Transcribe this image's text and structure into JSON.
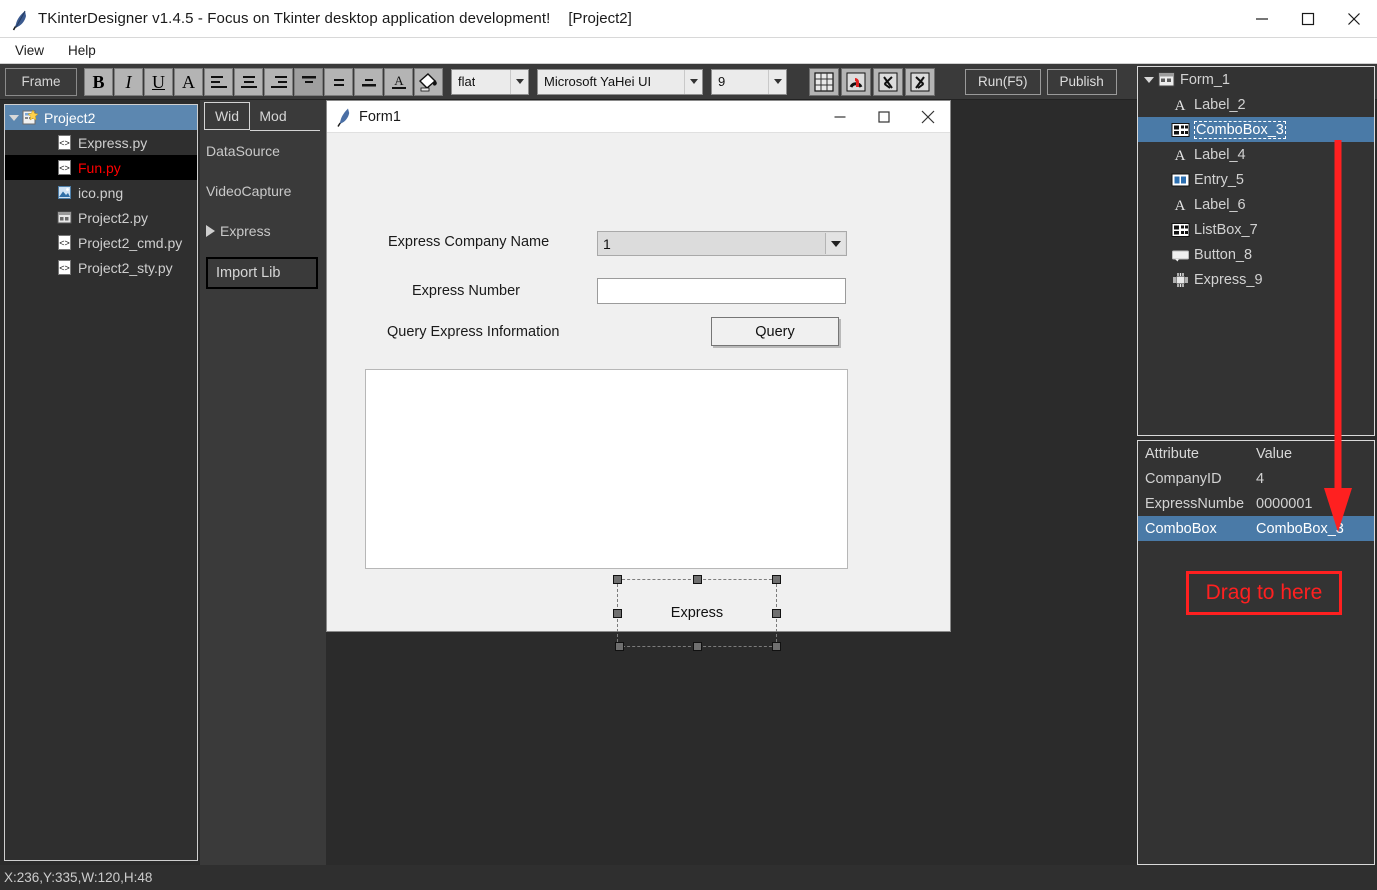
{
  "window": {
    "title": "TKinterDesigner v1.4.5 - Focus on Tkinter desktop application development!",
    "project_tag": "[Project2]",
    "app_icon": "feather-icon",
    "minimize": "minimize-icon",
    "maximize": "maximize-icon",
    "close": "close-icon"
  },
  "menubar": {
    "items": [
      {
        "label": "View"
      },
      {
        "label": "Help"
      }
    ]
  },
  "toolbar": {
    "frame_label": "Frame",
    "bold": "B",
    "italic": "I",
    "underline": "U",
    "font_letter": "A",
    "align_buttons": [
      "align-left-icon",
      "align-center-icon",
      "align-right-icon",
      "align-top-icon",
      "align-middle-icon",
      "align-bottom-icon"
    ],
    "text_color": "A",
    "fill_color_icon": "paint-bucket-icon",
    "relief_value": "flat",
    "font_family_value": "Microsoft YaHei UI",
    "font_size_value": "9",
    "grid_icon": "grid-icon",
    "magnet_icon": "magnet-icon",
    "undo_icon": "undo-icon",
    "redo_icon": "redo-icon",
    "run_label": "Run(F5)",
    "publish_label": "Publish"
  },
  "project_tree": {
    "root": {
      "label": "Project2",
      "icon": "project-icon",
      "expanded": true
    },
    "items": [
      {
        "label": "Express.py",
        "icon": "code-file-icon",
        "state": "normal"
      },
      {
        "label": "Fun.py",
        "icon": "code-file-icon",
        "state": "active"
      },
      {
        "label": "ico.png",
        "icon": "image-file-icon",
        "state": "normal"
      },
      {
        "label": "Project2.py",
        "icon": "form-file-icon",
        "state": "normal"
      },
      {
        "label": "Project2_cmd.py",
        "icon": "code-file-icon",
        "state": "normal"
      },
      {
        "label": "Project2_sty.py",
        "icon": "code-file-icon",
        "state": "normal"
      }
    ]
  },
  "widget_panel": {
    "tabs": [
      {
        "label": "Wid",
        "active": true
      },
      {
        "label": "Mod",
        "active": false
      }
    ],
    "items": [
      {
        "label": "DataSource",
        "expandable": false
      },
      {
        "label": "VideoCapture",
        "expandable": false
      },
      {
        "label": "Express",
        "expandable": true
      }
    ],
    "import_lib_label": "Import Lib"
  },
  "form": {
    "title": "Form1",
    "icon": "feather-icon",
    "minimize": "minimize-icon",
    "maximize": "maximize-icon",
    "close": "close-icon",
    "label_company": "Express Company Name",
    "label_number": "Express Number",
    "label_query": "Query Express Information",
    "combobox_value": "1",
    "entry_value": "",
    "query_button": "Query",
    "selected_widget_label": "Express"
  },
  "right_tree": {
    "root": {
      "label": "Form_1",
      "icon": "form-icon",
      "expanded": true
    },
    "items": [
      {
        "label": "Label_2",
        "icon": "label-icon",
        "selected": false
      },
      {
        "label": "ComboBox_3",
        "icon": "combobox-icon",
        "selected": true
      },
      {
        "label": "Label_4",
        "icon": "label-icon",
        "selected": false
      },
      {
        "label": "Entry_5",
        "icon": "entry-icon",
        "selected": false
      },
      {
        "label": "Label_6",
        "icon": "label-icon",
        "selected": false
      },
      {
        "label": "ListBox_7",
        "icon": "listbox-icon",
        "selected": false
      },
      {
        "label": "Button_8",
        "icon": "button-icon",
        "selected": false
      },
      {
        "label": "Express_9",
        "icon": "express-icon",
        "selected": false
      }
    ]
  },
  "attributes": {
    "headers": {
      "attribute": "Attribute",
      "value": "Value"
    },
    "rows": [
      {
        "attribute": "CompanyID",
        "value": "4",
        "selected": false
      },
      {
        "attribute": "ExpressNumbe",
        "value": "0000001",
        "selected": false
      },
      {
        "attribute": "ComboBox",
        "value": "ComboBox_3",
        "selected": true
      }
    ],
    "drag_hint": "Drag to here"
  },
  "annotation": {
    "arrow_color": "#ff2020",
    "arrow_icon": "down-arrow-annotation"
  },
  "statusbar": {
    "text": "X:236,Y:335,W:120,H:48"
  }
}
